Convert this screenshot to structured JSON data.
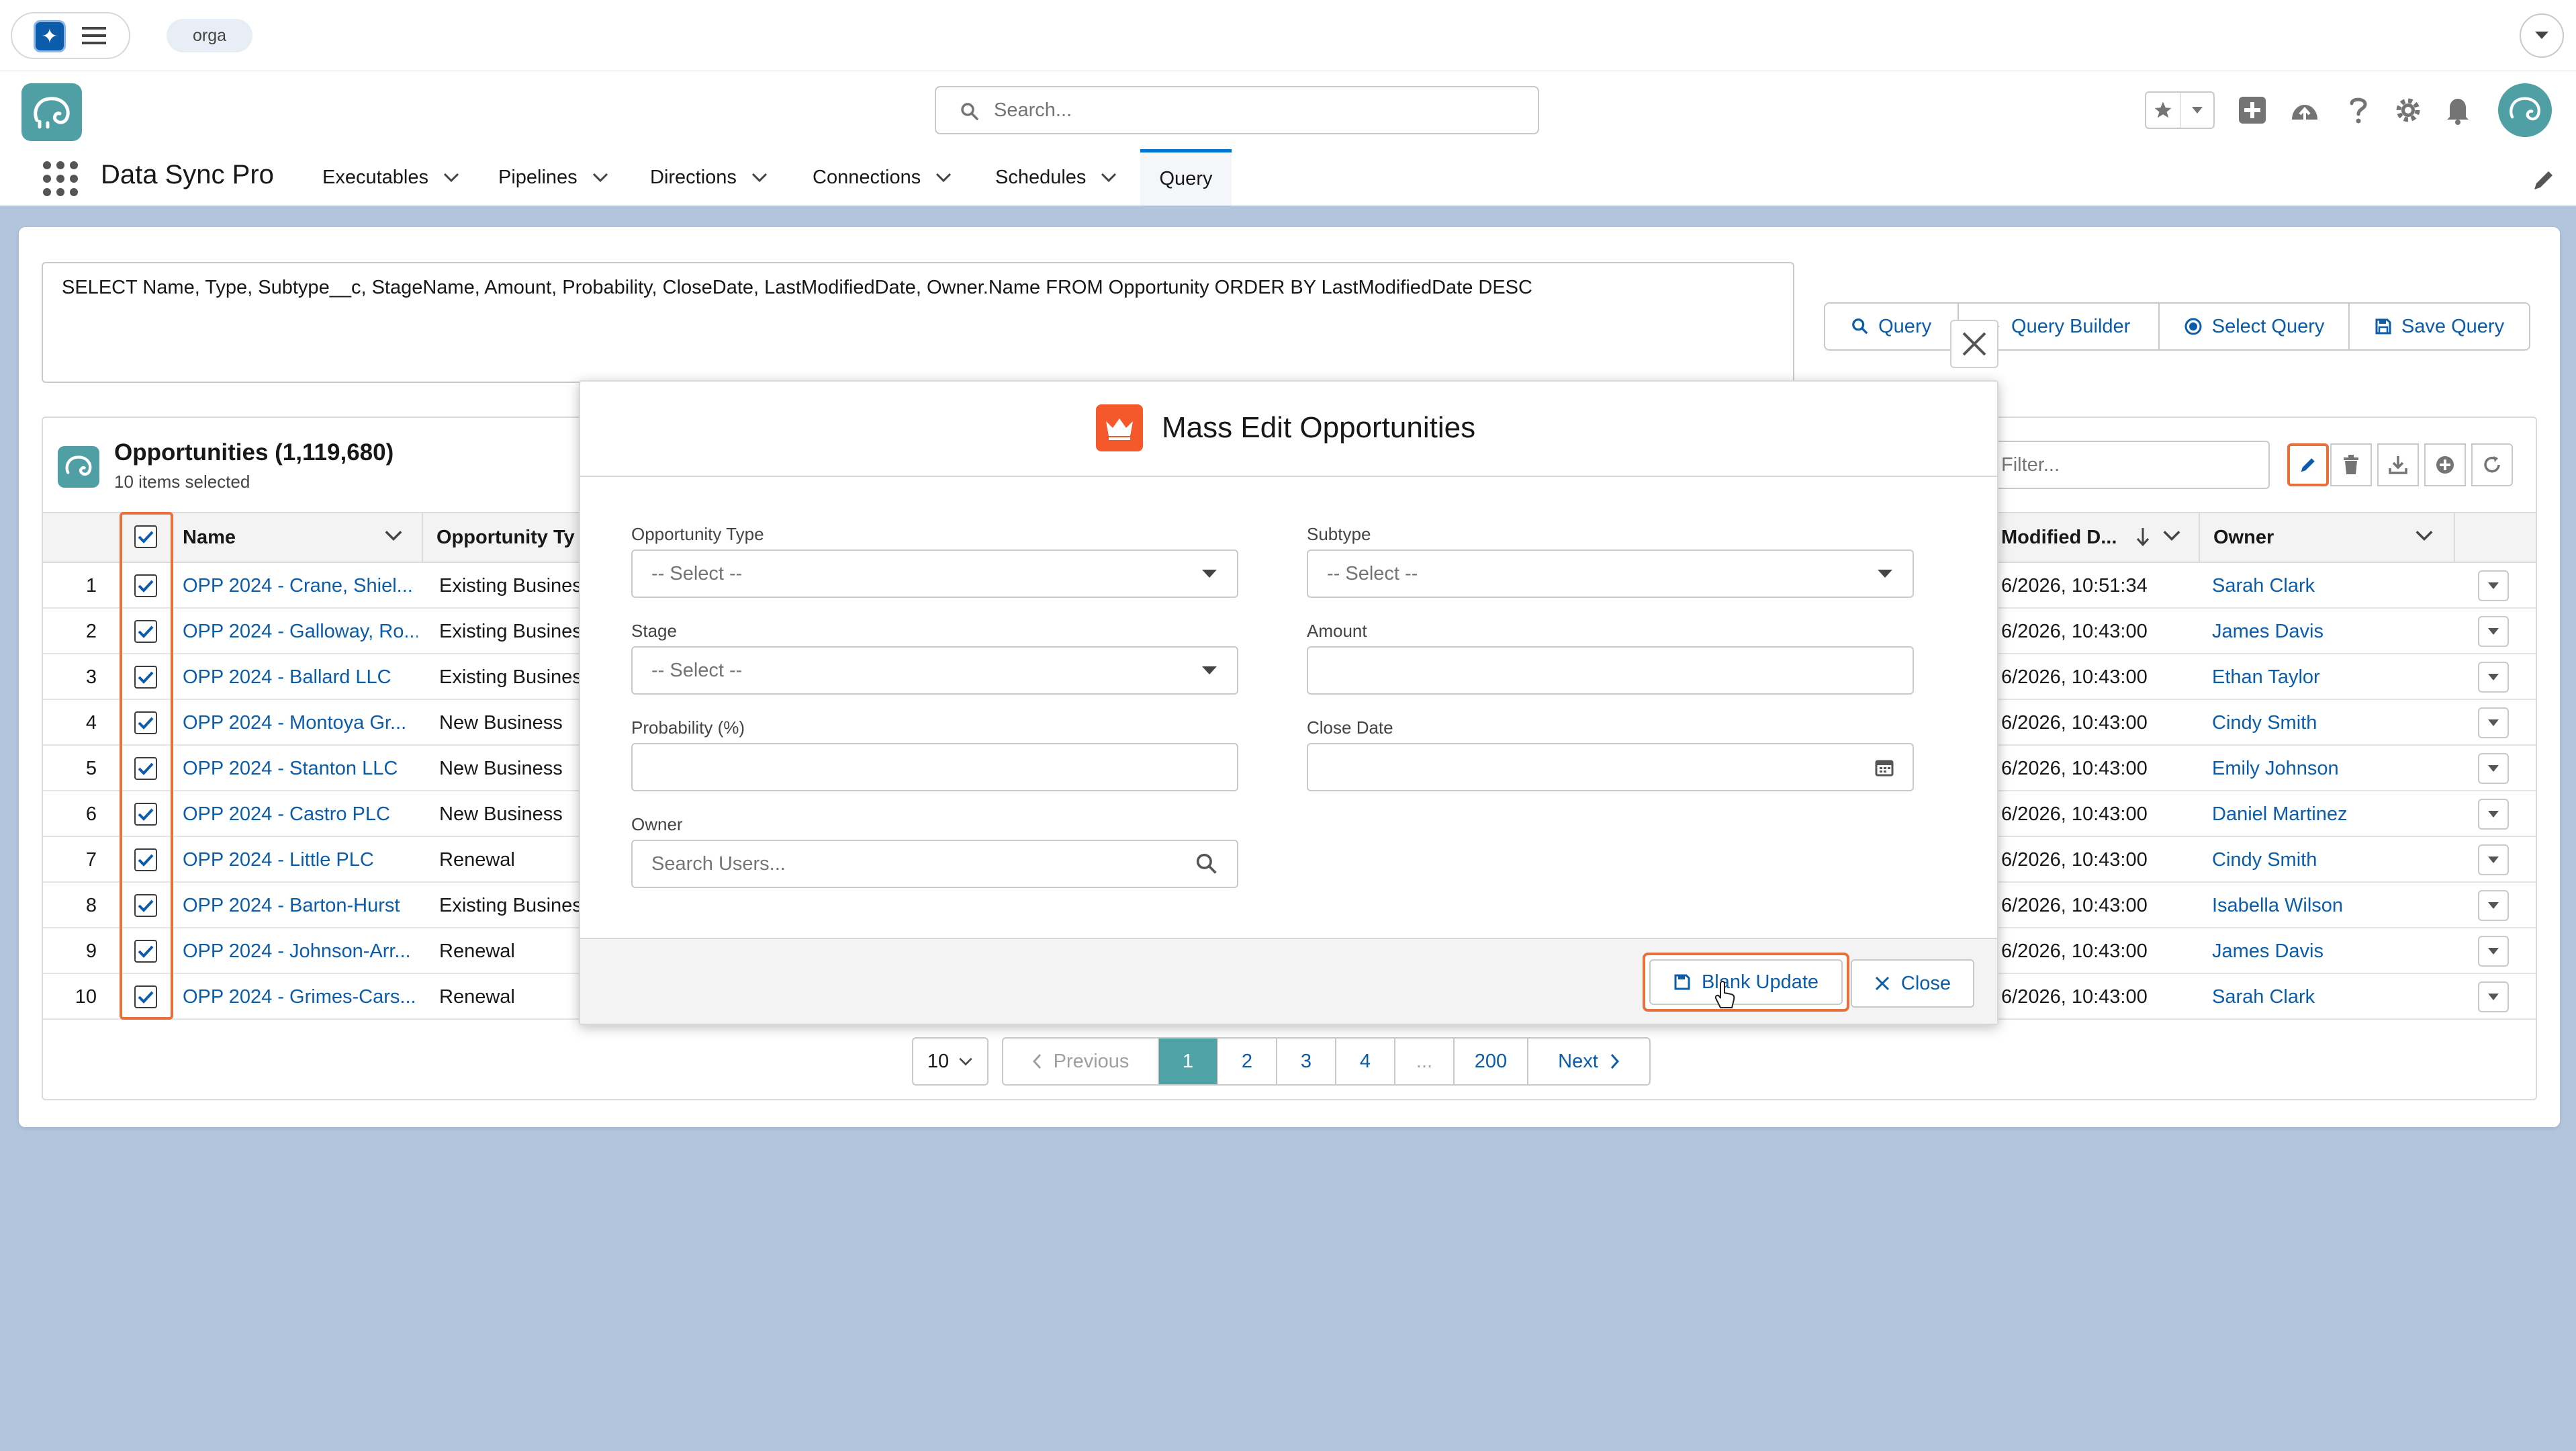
{
  "utility_bar": {
    "org": "orga"
  },
  "header": {
    "search_placeholder": "Search...",
    "app_name": "Data Sync Pro",
    "nav": [
      {
        "label": "Executables"
      },
      {
        "label": "Pipelines"
      },
      {
        "label": "Directions"
      },
      {
        "label": "Connections"
      },
      {
        "label": "Schedules"
      },
      {
        "label": "Query"
      }
    ]
  },
  "query": {
    "soql": "SELECT Name, Type, Subtype__c, StageName, Amount, Probability, CloseDate, LastModifiedDate, Owner.Name FROM Opportunity ORDER BY LastModifiedDate DESC",
    "buttons": {
      "query": "Query",
      "query_builder": "Query Builder",
      "select_query": "Select Query",
      "save_query": "Save Query"
    }
  },
  "results": {
    "title": "Opportunities (1,119,680)",
    "subtitle": "10 items selected",
    "filter_placeholder": "Filter...",
    "columns": {
      "name": "Name",
      "type": "Opportunity Ty",
      "modified": "Modified D...",
      "owner": "Owner"
    },
    "rows": [
      {
        "num": "1",
        "name": "OPP 2024 - Crane, Shiel...",
        "type": "Existing Business",
        "modified": "6/2026, 10:51:34",
        "owner": "Sarah Clark"
      },
      {
        "num": "2",
        "name": "OPP 2024 - Galloway, Ro...",
        "type": "Existing Business",
        "modified": "6/2026, 10:43:00",
        "owner": "James Davis"
      },
      {
        "num": "3",
        "name": "OPP 2024 - Ballard LLC",
        "type": "Existing Business",
        "modified": "6/2026, 10:43:00",
        "owner": "Ethan Taylor"
      },
      {
        "num": "4",
        "name": "OPP 2024 - Montoya Gr...",
        "type": "New Business",
        "modified": "6/2026, 10:43:00",
        "owner": "Cindy Smith"
      },
      {
        "num": "5",
        "name": "OPP 2024 - Stanton LLC",
        "type": "New Business",
        "modified": "6/2026, 10:43:00",
        "owner": "Emily Johnson"
      },
      {
        "num": "6",
        "name": "OPP 2024 - Castro PLC",
        "type": "New Business",
        "modified": "6/2026, 10:43:00",
        "owner": "Daniel Martinez"
      },
      {
        "num": "7",
        "name": "OPP 2024 - Little PLC",
        "type": "Renewal",
        "modified": "6/2026, 10:43:00",
        "owner": "Cindy Smith"
      },
      {
        "num": "8",
        "name": "OPP 2024 - Barton-Hurst",
        "type": "Existing Business",
        "modified": "6/2026, 10:43:00",
        "owner": "Isabella Wilson"
      },
      {
        "num": "9",
        "name": "OPP 2024 - Johnson-Arr...",
        "type": "Renewal",
        "modified": "6/2026, 10:43:00",
        "owner": "James Davis"
      },
      {
        "num": "10",
        "name": "OPP 2024 - Grimes-Cars...",
        "type": "Renewal",
        "modified": "6/2026, 10:43:00",
        "owner": "Sarah Clark"
      }
    ]
  },
  "pagination": {
    "page_size": "10",
    "previous": "Previous",
    "next": "Next",
    "pages": [
      "1",
      "2",
      "3",
      "4",
      "...",
      "200"
    ],
    "current": "1"
  },
  "modal": {
    "title": "Mass Edit Opportunities",
    "fields": {
      "opportunity_type": {
        "label": "Opportunity Type",
        "value": "-- Select --"
      },
      "subtype": {
        "label": "Subtype",
        "value": "-- Select --"
      },
      "stage": {
        "label": "Stage",
        "value": "-- Select --"
      },
      "amount": {
        "label": "Amount",
        "value": ""
      },
      "probability": {
        "label": "Probability (%)",
        "value": ""
      },
      "close_date": {
        "label": "Close Date",
        "value": ""
      },
      "owner": {
        "label": "Owner",
        "placeholder": "Search Users..."
      }
    },
    "blank_update": "Blank Update",
    "close": "Close"
  },
  "colors": {
    "brand": "#0b5cab",
    "highlight": "#e8703a",
    "teal": "#4fa3a6",
    "modal_icon": "#f4582b"
  }
}
